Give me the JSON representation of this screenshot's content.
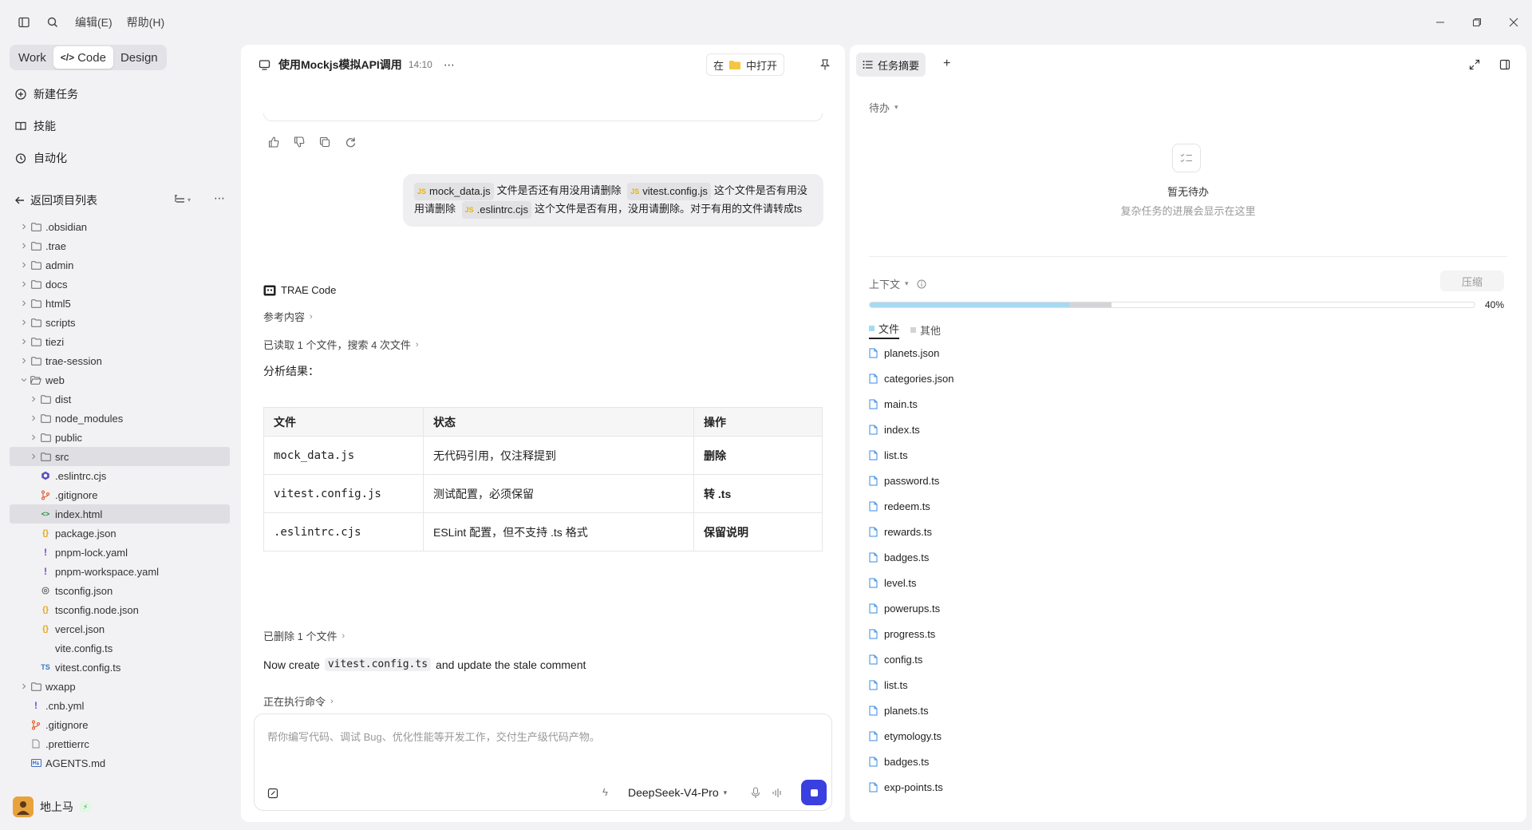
{
  "menu": {
    "edit": "编辑(E)",
    "help": "帮助(H)"
  },
  "modes": {
    "work": "Work",
    "code": "Code",
    "design": "Design"
  },
  "nav": {
    "new_task": "新建任务",
    "skills": "技能",
    "automation": "自动化"
  },
  "project": {
    "back_label": "返回项目列表"
  },
  "tree": [
    {
      "name": ".obsidian",
      "type": "folder",
      "depth": 0,
      "expanded": false,
      "icon": "folder-icon"
    },
    {
      "name": ".trae",
      "type": "folder",
      "depth": 0,
      "expanded": false,
      "icon": "folder-icon"
    },
    {
      "name": "admin",
      "type": "folder",
      "depth": 0,
      "expanded": false,
      "icon": "folder-icon"
    },
    {
      "name": "docs",
      "type": "folder",
      "depth": 0,
      "expanded": false,
      "icon": "folder-icon"
    },
    {
      "name": "html5",
      "type": "folder",
      "depth": 0,
      "expanded": false,
      "icon": "folder-icon"
    },
    {
      "name": "scripts",
      "type": "folder",
      "depth": 0,
      "expanded": false,
      "icon": "folder-icon"
    },
    {
      "name": "tiezi",
      "type": "folder",
      "depth": 0,
      "expanded": false,
      "icon": "folder-icon"
    },
    {
      "name": "trae-session",
      "type": "folder",
      "depth": 0,
      "expanded": false,
      "icon": "folder-icon"
    },
    {
      "name": "web",
      "type": "folder",
      "depth": 0,
      "expanded": true,
      "icon": "folder-open-icon"
    },
    {
      "name": "dist",
      "type": "folder",
      "depth": 1,
      "expanded": false,
      "icon": "folder-icon"
    },
    {
      "name": "node_modules",
      "type": "folder",
      "depth": 1,
      "expanded": false,
      "icon": "folder-icon"
    },
    {
      "name": "public",
      "type": "folder",
      "depth": 1,
      "expanded": false,
      "icon": "folder-icon"
    },
    {
      "name": "src",
      "type": "folder",
      "depth": 1,
      "expanded": false,
      "icon": "folder-icon",
      "selected": true
    },
    {
      "name": ".eslintrc.cjs",
      "type": "file",
      "depth": 1,
      "icon": "eslint-icon"
    },
    {
      "name": ".gitignore",
      "type": "file",
      "depth": 1,
      "icon": "git-icon"
    },
    {
      "name": "index.html",
      "type": "file",
      "depth": 1,
      "icon": "html-icon",
      "selected": true
    },
    {
      "name": "package.json",
      "type": "file",
      "depth": 1,
      "icon": "json-icon"
    },
    {
      "name": "pnpm-lock.yaml",
      "type": "file",
      "depth": 1,
      "icon": "yaml-icon"
    },
    {
      "name": "pnpm-workspace.yaml",
      "type": "file",
      "depth": 1,
      "icon": "yaml-icon"
    },
    {
      "name": "tsconfig.json",
      "type": "file",
      "depth": 1,
      "icon": "tsconfig-icon"
    },
    {
      "name": "tsconfig.node.json",
      "type": "file",
      "depth": 1,
      "icon": "json-icon"
    },
    {
      "name": "vercel.json",
      "type": "file",
      "depth": 1,
      "icon": "json-icon"
    },
    {
      "name": "vite.config.ts",
      "type": "file",
      "depth": 1,
      "icon": "none"
    },
    {
      "name": "vitest.config.ts",
      "type": "file",
      "depth": 1,
      "icon": "ts-icon"
    },
    {
      "name": "wxapp",
      "type": "folder",
      "depth": 0,
      "expanded": false,
      "icon": "folder-icon"
    },
    {
      "name": ".cnb.yml",
      "type": "file",
      "depth": 0,
      "icon": "yaml-icon"
    },
    {
      "name": ".gitignore",
      "type": "file",
      "depth": 0,
      "icon": "git-icon"
    },
    {
      "name": ".prettierrc",
      "type": "file",
      "depth": 0,
      "icon": "file-icon"
    },
    {
      "name": "AGENTS.md",
      "type": "file",
      "depth": 0,
      "icon": "markdown-icon"
    }
  ],
  "user": {
    "name": "地上马"
  },
  "chat": {
    "title": "使用Mockjs模拟API调用",
    "time": "14:10",
    "open_in_prefix": "在",
    "open_in_suffix": "中打开",
    "user_message": {
      "file1": "mock_data.js",
      "text1": "文件是否还有用没用请删除",
      "file2": "vitest.config.js",
      "text2": "这个文件是否有用没用请删除",
      "file3": ".eslintrc.cjs",
      "text3": "这个文件是否有用，没用请删除。对于有用的文件请转成ts",
      "chip_badge": "JS"
    },
    "assistant_name": "TRAE Code",
    "ref_label": "参考内容",
    "read_label": "已读取 1 个文件，搜索 4 次文件",
    "analysis_title": "分析结果：",
    "table": {
      "headers": [
        "文件",
        "状态",
        "操作"
      ],
      "rows": [
        {
          "file": "mock_data.js",
          "status": "无代码引用，仅注释提到",
          "action": "删除"
        },
        {
          "file": "vitest.config.js",
          "status": "测试配置，必须保留",
          "action": "转 .ts"
        },
        {
          "file": ".eslintrc.cjs",
          "status": "ESLint 配置，但不支持 .ts 格式",
          "action": "保留说明"
        }
      ]
    },
    "deleted_label": "已删除 1 个文件",
    "now_create_pre": "Now create",
    "now_create_code": "vitest.config.ts",
    "now_create_post": "and update the stale comment",
    "executing_label": "正在执行命令",
    "input_placeholder": "帮你编写代码、调试 Bug、优化性能等开发工作，交付生产级代码产物。",
    "model": "DeepSeek-V4-Pro"
  },
  "right": {
    "tab_label": "任务摘要",
    "todo_label": "待办",
    "empty_title": "暂无待办",
    "empty_sub": "复杂任务的进展会显示在这里",
    "context_label": "上下文",
    "compress_label": "压缩",
    "progress_text": "40%",
    "progress": {
      "files_fraction": 0.33,
      "other_fraction": 0.07
    },
    "legend_files": "文件",
    "legend_other": "其他",
    "files": [
      "planets.json",
      "categories.json",
      "main.ts",
      "index.ts",
      "list.ts",
      "password.ts",
      "redeem.ts",
      "rewards.ts",
      "badges.ts",
      "level.ts",
      "powerups.ts",
      "progress.ts",
      "config.ts",
      "list.ts",
      "planets.ts",
      "etymology.ts",
      "badges.ts",
      "exp-points.ts"
    ]
  },
  "colors": {
    "accent": "#3a3fe0",
    "progress_files": "#a6daf0",
    "progress_other": "#d4d4d8",
    "folder": "#666666"
  }
}
